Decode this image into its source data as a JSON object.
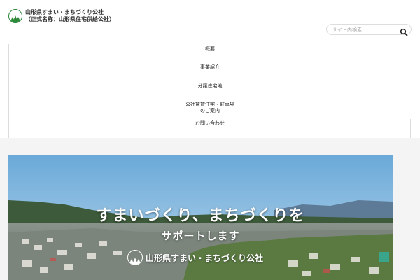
{
  "header": {
    "logo_line1": "山形県すまい・まちづくり公社",
    "logo_line2": "（正式名称：山形県住宅供給公社）",
    "search_placeholder": "サイト内検索"
  },
  "nav": {
    "items": [
      {
        "label": "概要"
      },
      {
        "label": "事業紹介"
      },
      {
        "label": "分譲住宅地"
      },
      {
        "label": "公社賃貸住宅・駐車場のご案内"
      },
      {
        "label": "お問い合わせ"
      }
    ]
  },
  "hero": {
    "title": "すまいづくり、まちづくりを",
    "subtitle": "サポートします",
    "brand": "山形県すまい・まちづくり公社"
  },
  "colors": {
    "brand_green": "#2c8a3a",
    "sky_top": "#6aa9d8",
    "sky_bottom": "#b7d6ec"
  },
  "icons": {
    "search": "search-icon",
    "logo": "mountain-logo-icon"
  }
}
